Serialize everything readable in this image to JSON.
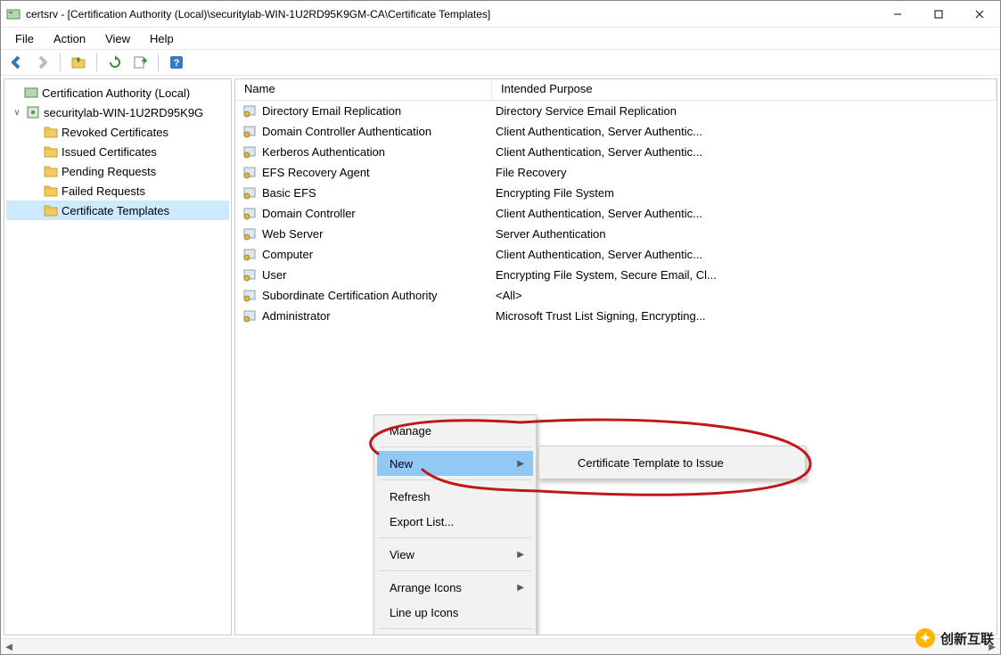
{
  "title": "certsrv - [Certification Authority (Local)\\securitylab-WIN-1U2RD95K9GM-CA\\Certificate Templates]",
  "menus": {
    "file": "File",
    "action": "Action",
    "view": "View",
    "help": "Help"
  },
  "tree": {
    "root": "Certification Authority (Local)",
    "ca": "securitylab-WIN-1U2RD95K9G",
    "nodes": [
      "Revoked Certificates",
      "Issued Certificates",
      "Pending Requests",
      "Failed Requests",
      "Certificate Templates"
    ]
  },
  "columns": {
    "name": "Name",
    "purpose": "Intended Purpose"
  },
  "rows": [
    {
      "name": "Directory Email Replication",
      "purpose": "Directory Service Email Replication"
    },
    {
      "name": "Domain Controller Authentication",
      "purpose": "Client Authentication, Server Authentic..."
    },
    {
      "name": "Kerberos Authentication",
      "purpose": "Client Authentication, Server Authentic..."
    },
    {
      "name": "EFS Recovery Agent",
      "purpose": "File Recovery"
    },
    {
      "name": "Basic EFS",
      "purpose": "Encrypting File System"
    },
    {
      "name": "Domain Controller",
      "purpose": "Client Authentication, Server Authentic..."
    },
    {
      "name": "Web Server",
      "purpose": "Server Authentication"
    },
    {
      "name": "Computer",
      "purpose": "Client Authentication, Server Authentic..."
    },
    {
      "name": "User",
      "purpose": "Encrypting File System, Secure Email, Cl..."
    },
    {
      "name": "Subordinate Certification Authority",
      "purpose": "<All>"
    },
    {
      "name": "Administrator",
      "purpose": "Microsoft Trust List Signing, Encrypting..."
    }
  ],
  "context": {
    "manage": "Manage",
    "new": "New",
    "refresh": "Refresh",
    "export": "Export List...",
    "view": "View",
    "arrange": "Arrange Icons",
    "lineup": "Line up Icons"
  },
  "submenu": {
    "issue": "Certificate Template to Issue"
  },
  "watermark": "创新互联"
}
